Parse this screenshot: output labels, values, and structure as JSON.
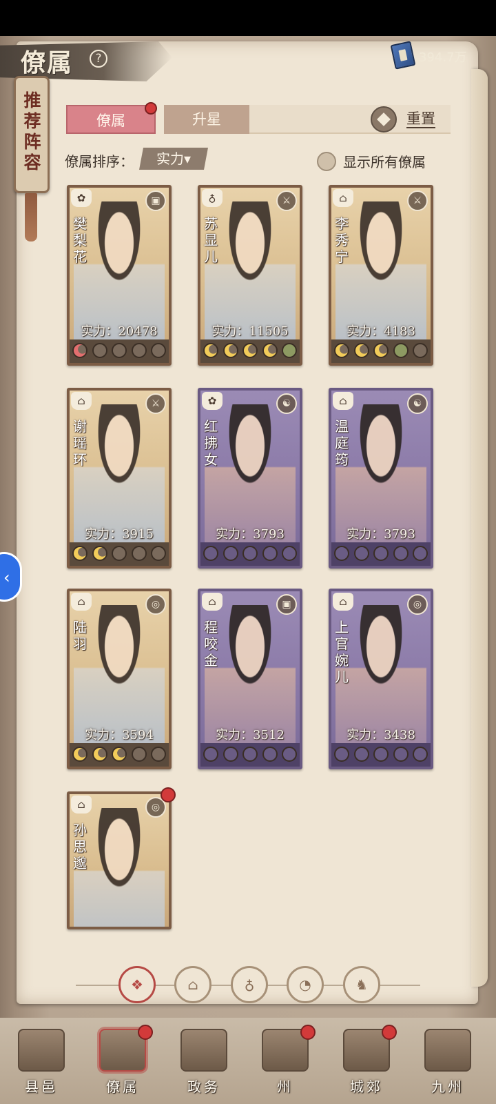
{
  "header": {
    "title": "僚属",
    "help_glyph": "?",
    "currency_value": "394.7万"
  },
  "side_tag": {
    "label": "推荐阵容"
  },
  "tabs": [
    {
      "label": "僚属",
      "active": true,
      "has_dot": true
    },
    {
      "label": "升星",
      "active": false
    }
  ],
  "reset_label": "重置",
  "sort": {
    "label": "僚属排序：",
    "selected": "实力▾"
  },
  "show_all": {
    "label": "显示所有僚属",
    "checked": false
  },
  "power_prefix": "实力：",
  "cards": [
    {
      "name": "樊梨花",
      "power": "实力：20478",
      "rarity": "gold",
      "stars": [
        "red",
        "off",
        "off",
        "off",
        "off"
      ]
    },
    {
      "name": "苏显儿",
      "power": "实力：11505",
      "rarity": "gold",
      "stars": [
        "on",
        "on",
        "on",
        "on",
        "green"
      ]
    },
    {
      "name": "李秀宁",
      "power": "实力：4183",
      "rarity": "gold",
      "stars": [
        "on",
        "on",
        "on",
        "green",
        "off"
      ]
    },
    {
      "name": "谢瑶环",
      "power": "实力：3915",
      "rarity": "gold",
      "stars": [
        "on",
        "on",
        "off",
        "off",
        "off"
      ]
    },
    {
      "name": "红拂女",
      "power": "实力：3793",
      "rarity": "purple",
      "stars": [
        "on",
        "on",
        "off",
        "off",
        "off"
      ]
    },
    {
      "name": "温庭筠",
      "power": "实力：3793",
      "rarity": "purple",
      "stars": [
        "on",
        "on",
        "off",
        "off",
        "off"
      ]
    },
    {
      "name": "陆羽",
      "power": "实力：3594",
      "rarity": "gold",
      "stars": [
        "on",
        "on",
        "on",
        "off",
        "off"
      ]
    },
    {
      "name": "程咬金",
      "power": "实力：3512",
      "rarity": "purple",
      "stars": [
        "on",
        "on",
        "off",
        "off",
        "off"
      ]
    },
    {
      "name": "上官婉儿",
      "power": "实力：3438",
      "rarity": "purple",
      "stars": [
        "on",
        "on",
        "on",
        "green",
        "off"
      ]
    },
    {
      "name": "孙思邈",
      "power": "",
      "rarity": "gold",
      "stars": [],
      "has_dot": true
    }
  ],
  "filters": [
    "all-icon",
    "wen-icon",
    "gourd-icon",
    "fan-icon",
    "lion-icon"
  ],
  "nav": [
    {
      "label": "县邑",
      "has_dot": false
    },
    {
      "label": "僚属",
      "has_dot": true,
      "active": true
    },
    {
      "label": "政务",
      "has_dot": false
    },
    {
      "label": "州",
      "has_dot": true
    },
    {
      "label": "城郊",
      "has_dot": true
    },
    {
      "label": "九州",
      "has_dot": false
    }
  ],
  "colors": {
    "accent_red": "#d23a3a",
    "tab_active": "#d9838a",
    "gold_card": "#e8d2aa",
    "purple_card": "#9b8bb5",
    "float_blue": "#2f6fe6"
  }
}
